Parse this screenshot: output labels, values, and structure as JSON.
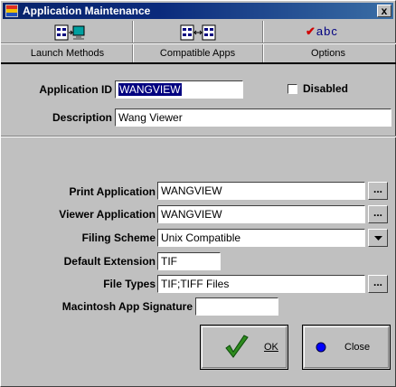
{
  "window": {
    "title": "Application Maintenance",
    "close_glyph": "x"
  },
  "tabs": [
    {
      "label": "Launch Methods",
      "icon": "launch-methods-icon"
    },
    {
      "label": "Compatible Apps",
      "icon": "compatible-apps-icon"
    },
    {
      "label": "Options",
      "icon": "options-checkbox-icon",
      "icon_text": "abc"
    }
  ],
  "form": {
    "application_id": {
      "label": "Application ID",
      "value": "WANGVIEW"
    },
    "disabled": {
      "label": "Disabled",
      "checked": false
    },
    "description": {
      "label": "Description",
      "value": "Wang Viewer"
    },
    "print_application": {
      "label": "Print Application",
      "value": "WANGVIEW"
    },
    "viewer_application": {
      "label": "Viewer Application",
      "value": "WANGVIEW"
    },
    "filing_scheme": {
      "label": "Filing Scheme",
      "value": "Unix Compatible"
    },
    "default_extension": {
      "label": "Default Extension",
      "value": "TIF"
    },
    "file_types": {
      "label": "File Types",
      "value": "TIF;TIFF Files"
    },
    "mac_signature": {
      "label": "Macintosh App Signature",
      "value": ""
    }
  },
  "buttons": {
    "browse_glyph": "...",
    "ok_label": "OK",
    "close_label": "Close"
  },
  "colors": {
    "title_bar": "#08246b",
    "window_face": "#c0c0c0",
    "selection": "#000080",
    "ok_check": "#2e8b1e",
    "close_dot": "#0000ff"
  }
}
